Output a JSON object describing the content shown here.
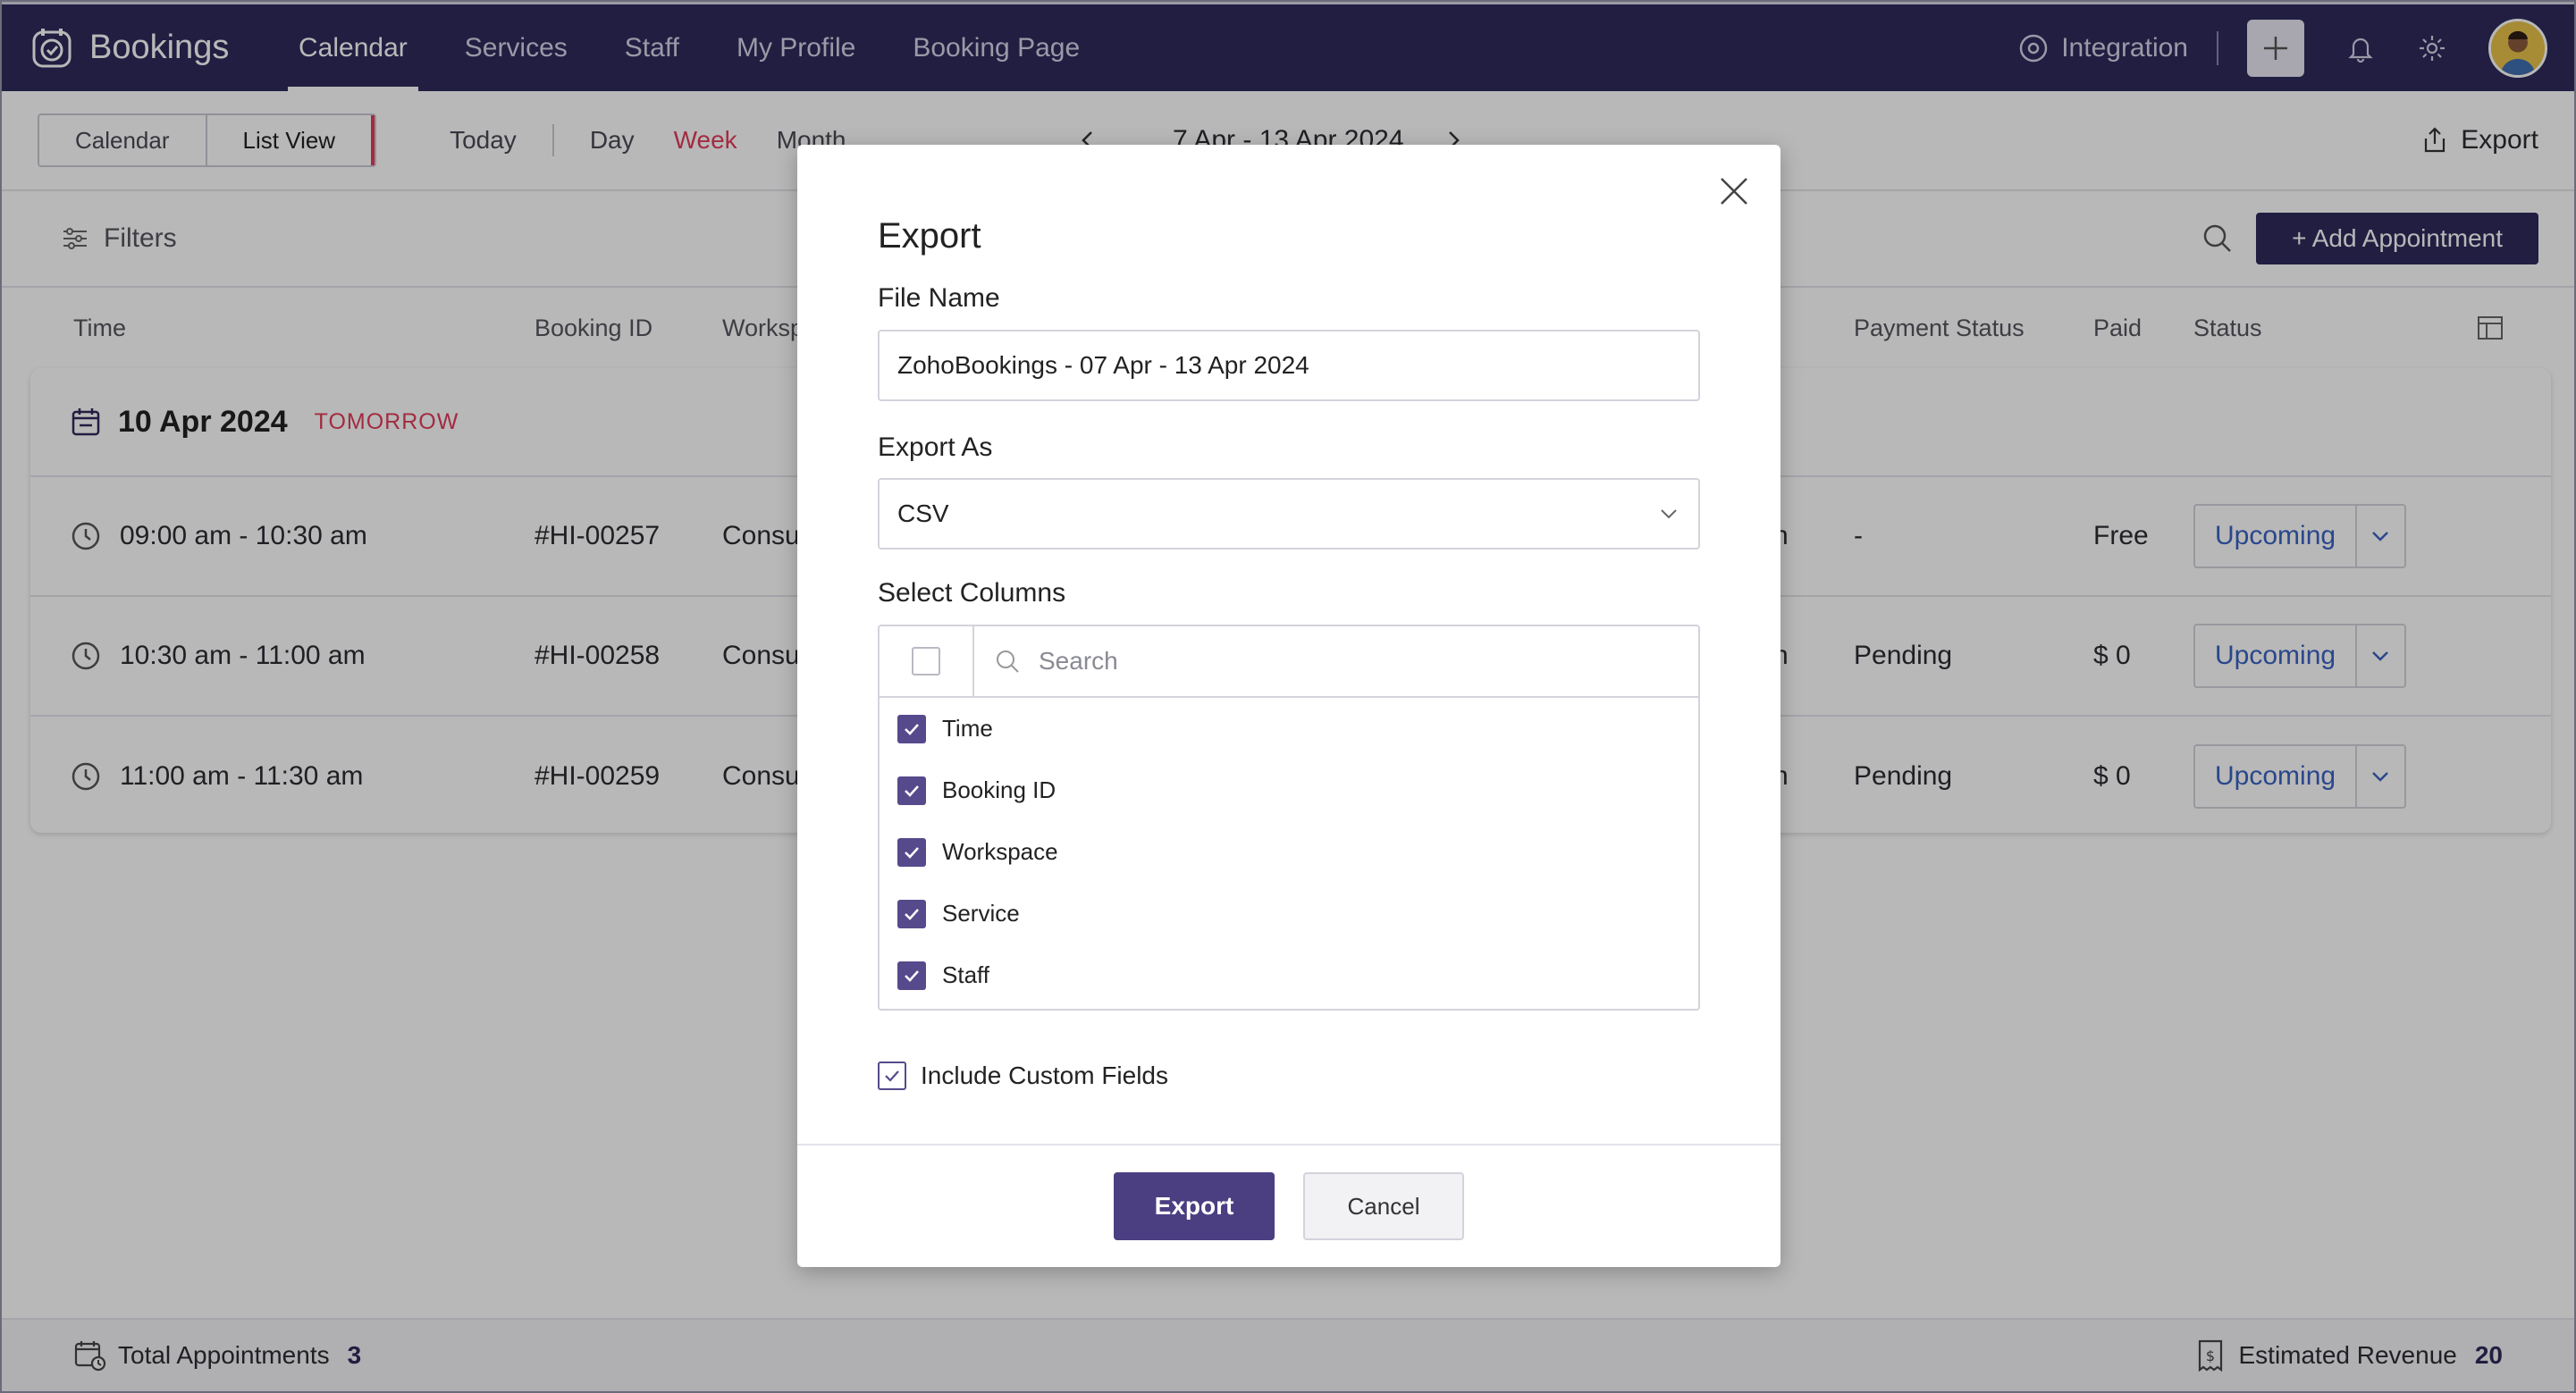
{
  "brand": {
    "name": "Bookings"
  },
  "nav": {
    "items": [
      {
        "label": "Calendar",
        "active": true
      },
      {
        "label": "Services",
        "active": false
      },
      {
        "label": "Staff",
        "active": false
      },
      {
        "label": "My Profile",
        "active": false
      },
      {
        "label": "Booking Page",
        "active": false
      }
    ],
    "integration": "Integration"
  },
  "toolbar": {
    "view_calendar": "Calendar",
    "view_list": "List View",
    "today": "Today",
    "day": "Day",
    "week": "Week",
    "month": "Month",
    "date_range": "7 Apr - 13 Apr 2024",
    "export": "Export"
  },
  "filters": {
    "label": "Filters",
    "add_button": "+ Add Appointment"
  },
  "table": {
    "headers": {
      "time": "Time",
      "booking_id": "Booking ID",
      "workspace": "Worksp",
      "payment_status": "Payment Status",
      "paid": "Paid",
      "status": "Status"
    },
    "day": {
      "date": "10 Apr 2024",
      "tag": "TOMORROW"
    },
    "rows": [
      {
        "time": "09:00 am - 10:30 am",
        "booking_id": "#HI-00257",
        "workspace": "Consu",
        "staff_tail": "n",
        "payment": "-",
        "paid": "Free",
        "status": "Upcoming"
      },
      {
        "time": "10:30 am - 11:00 am",
        "booking_id": "#HI-00258",
        "workspace": "Consu",
        "staff_tail": "n",
        "payment": "Pending",
        "paid": "$ 0",
        "status": "Upcoming"
      },
      {
        "time": "11:00 am - 11:30 am",
        "booking_id": "#HI-00259",
        "workspace": "Consu",
        "staff_tail": "n",
        "payment": "Pending",
        "paid": "$ 0",
        "status": "Upcoming"
      }
    ]
  },
  "footer": {
    "total_label": "Total Appointments",
    "total_value": "3",
    "revenue_label": "Estimated Revenue",
    "revenue_value": "20"
  },
  "modal": {
    "title": "Export",
    "file_name_label": "File Name",
    "file_name_value": "ZohoBookings - 07 Apr - 13 Apr 2024",
    "export_as_label": "Export As",
    "export_as_value": "CSV",
    "select_columns_label": "Select Columns",
    "search_placeholder": "Search",
    "columns": [
      {
        "label": "Time",
        "checked": true
      },
      {
        "label": "Booking ID",
        "checked": true
      },
      {
        "label": "Workspace",
        "checked": true
      },
      {
        "label": "Service",
        "checked": true
      },
      {
        "label": "Staff",
        "checked": true
      }
    ],
    "include_custom_fields": "Include Custom Fields",
    "export_button": "Export",
    "cancel_button": "Cancel"
  },
  "colors": {
    "nav_bg": "#2f2a5c",
    "accent_red": "#e23c5a",
    "primary_button": "#4b3f82",
    "status_blue": "#3b63c2",
    "checkbox": "#564a8c"
  }
}
